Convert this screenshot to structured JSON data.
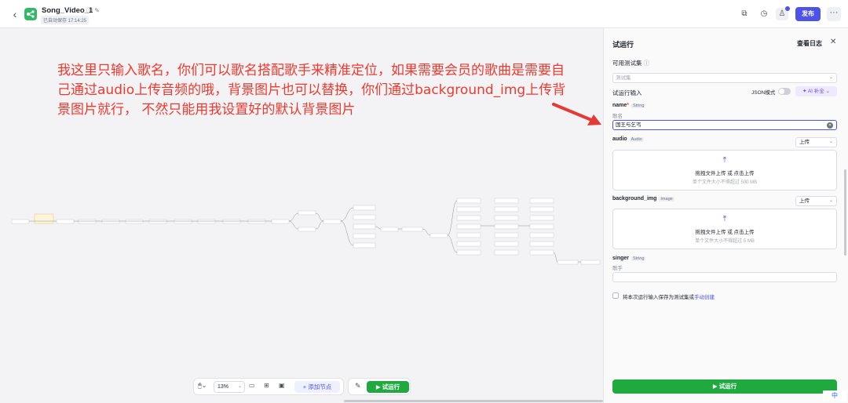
{
  "header": {
    "back_icon": "chevron-left-icon",
    "title": "Song_Video_1",
    "saved_label": "已自动保存 17:14:25",
    "publish_label": "发布",
    "more_label": "···"
  },
  "canvas": {
    "annotation": "我这里只输入歌名，你们可以歌名搭配歌手来精准定位，如果需要会员的歌曲是需要自己通过audio上传音频的哦，背景图片也可以替换，你们通过background_img上传背景图片就行， 不然只能用我设置好的默认背景图片",
    "toolbar": {
      "zoom": "13%",
      "add_node_label": "+ 添加节点",
      "run_label": "▶ 试运行"
    }
  },
  "panel": {
    "title": "试运行",
    "view_log_label": "查看日志",
    "close_label": "✕",
    "test_set_label": "可用测试集",
    "test_set_placeholder": "测试集",
    "test_input_label": "试运行输入",
    "json_mode_label": "JSON模式",
    "ai_fill_label": "✦ AI 补全",
    "fields": {
      "name": {
        "label": "name",
        "required_mark": "*",
        "type": "String",
        "desc": "歌名",
        "value": "国王与乞丐"
      },
      "audio": {
        "label": "audio",
        "type": "Audio",
        "mode": "上传",
        "upload_text": "拖拽文件上传 或 点击上传",
        "hint": "单个文件大小不得超过 500 MB"
      },
      "background_img": {
        "label": "background_img",
        "type": "Image",
        "mode": "上传",
        "upload_text": "拖拽文件上传 或 点击上传",
        "hint": "单个文件大小不得超过 5 MB"
      },
      "singer": {
        "label": "singer",
        "type": "String",
        "desc": "歌手",
        "value": ""
      }
    },
    "save_text": "将本次运行输入保存为测试集或",
    "save_link": "手动创建",
    "run_button_label": "▶ 试运行"
  },
  "ime": {
    "label": "中"
  },
  "colors": {
    "accent": "#4d53e8",
    "run_green": "#1fa93f",
    "annotation_red": "#ec3a2f"
  }
}
